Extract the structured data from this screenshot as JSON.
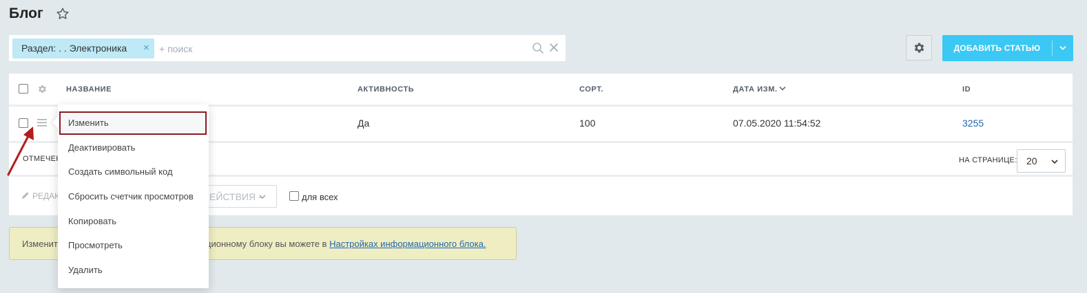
{
  "header": {
    "title": "Блог"
  },
  "filter": {
    "chip_label": "Раздел: . . Электроника",
    "chip_close": "×",
    "search_placeholder": "+ поиск"
  },
  "toolbar": {
    "add_article_label": "ДОБАВИТЬ СТАТЬЮ"
  },
  "table": {
    "columns": [
      "НАЗВАНИЕ",
      "АКТИВНОСТЬ",
      "СОРТ.",
      "ДАТА ИЗМ.",
      "ID"
    ],
    "rows": [
      {
        "name": "",
        "active": "Да",
        "sort": "100",
        "date": "07.05.2020 11:54:52",
        "id": "3255"
      }
    ],
    "selected_label": "ОТМЕЧЕН",
    "per_page_label": "НА СТРАНИЦЕ:",
    "per_page_value": "20",
    "edit_label": "РЕДАК",
    "actions_label": "ЕЙСТВИЯ -",
    "for_all_label": "для всех"
  },
  "info": {
    "prefix": "Изменит",
    "middle": "мационному блоку вы можете в ",
    "link_text": "Настройках информационного блока."
  },
  "context_menu": {
    "items": [
      "Изменить",
      "Деактивировать",
      "Создать символьный код",
      "Сбросить счетчик просмотров",
      "Копировать",
      "Просмотреть",
      "Удалить"
    ]
  },
  "colors": {
    "page_bg": "#e1e9ec",
    "accent": "#3bc8f5",
    "chip_bg": "#bfe9f6",
    "link": "#2067b0",
    "highlight_border": "#8b1a22",
    "arrow": "#b71c1c",
    "note_bg": "#efedc2"
  }
}
